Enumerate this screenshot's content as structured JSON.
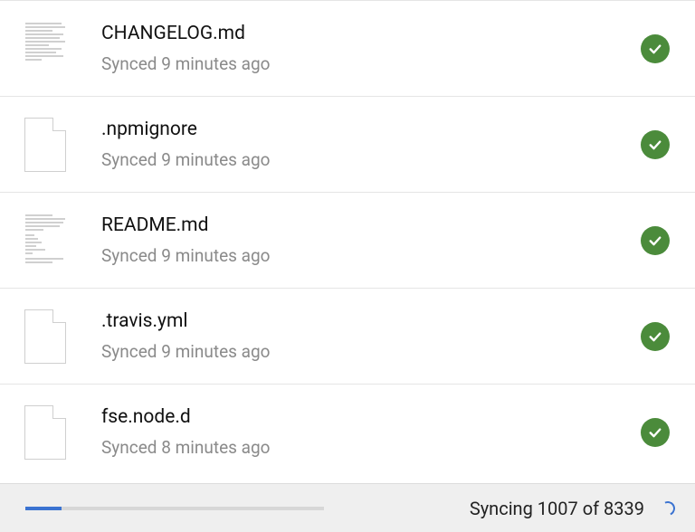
{
  "files": [
    {
      "name": "CHANGELOG.md",
      "status": "Synced 9 minutes ago",
      "thumb": "doc",
      "state": "synced"
    },
    {
      "name": ".npmignore",
      "status": "Synced 9 minutes ago",
      "thumb": "blank",
      "state": "synced"
    },
    {
      "name": "README.md",
      "status": "Synced 9 minutes ago",
      "thumb": "doc",
      "state": "synced"
    },
    {
      "name": ".travis.yml",
      "status": "Synced 9 minutes ago",
      "thumb": "blank",
      "state": "synced"
    },
    {
      "name": "fse.node.d",
      "status": "Synced 8 minutes ago",
      "thumb": "blank",
      "state": "synced"
    }
  ],
  "footer": {
    "sync_text": "Syncing 1007 of 8339",
    "progress_percent": 12,
    "colors": {
      "accent": "#3b73d1",
      "success": "#4b8b3b"
    }
  }
}
